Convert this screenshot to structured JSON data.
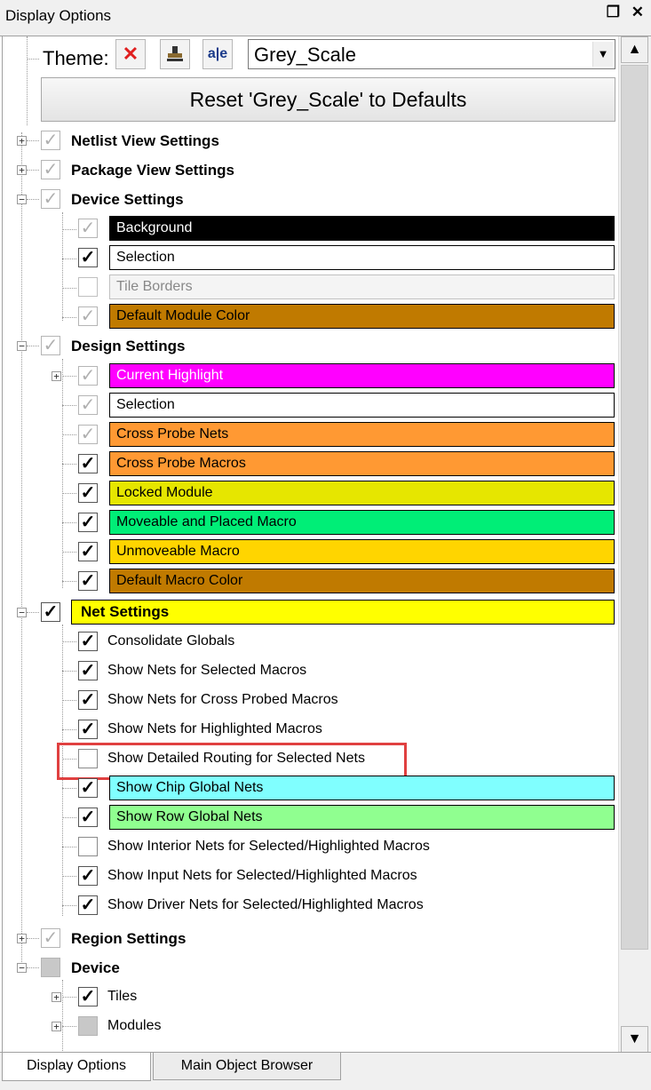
{
  "window": {
    "title": "Display Options",
    "pin_glyph": "❐",
    "close_glyph": "✕"
  },
  "theme": {
    "label": "Theme:",
    "delete_icon": "✕",
    "stamp_icon": "▒",
    "rename_icon": "a|e",
    "selected": "Grey_Scale",
    "reset_label": "Reset 'Grey_Scale' to Defaults"
  },
  "tree": {
    "netlist_view": "Netlist View Settings",
    "package_view": "Package View Settings",
    "device_settings": {
      "label": "Device Settings",
      "items": [
        "Background",
        "Selection",
        "Tile Borders",
        "Default Module Color"
      ]
    },
    "design_settings": {
      "label": "Design Settings",
      "items": [
        "Current Highlight",
        "Selection",
        "Cross Probe Nets",
        "Cross Probe Macros",
        "Locked Module",
        "Moveable and Placed Macro",
        "Unmoveable Macro",
        "Default Macro Color"
      ]
    },
    "net_settings": {
      "label": "Net Settings",
      "items": [
        "Consolidate Globals",
        "Show Nets for Selected Macros",
        "Show Nets for Cross Probed Macros",
        "Show Nets for Highlighted Macros",
        "Show Detailed Routing for Selected Nets",
        "Show Chip Global Nets",
        "Show Row Global Nets",
        "Show Interior Nets for Selected/Highlighted Macros",
        "Show Input Nets for Selected/Highlighted Macros",
        "Show Driver Nets for Selected/Highlighted Macros"
      ]
    },
    "region_settings": "Region Settings",
    "device": {
      "label": "Device",
      "items": [
        "Tiles",
        "Modules"
      ]
    }
  },
  "colors": {
    "background": "#000000",
    "selection": "#ffffff",
    "tile_borders": "#f4f4f4",
    "default_module": "#c07a00",
    "current_highlight": "#ff00ff",
    "cross_probe_nets": "#ff9933",
    "cross_probe_macros": "#ff9933",
    "locked_module": "#e6e600",
    "moveable_placed": "#00ee77",
    "unmoveable": "#ffd500",
    "default_macro": "#c07a00",
    "net_settings": "#ffff00",
    "chip_global": "#80ffff",
    "row_global": "#90ff90",
    "highlight_box": "#e04040"
  },
  "tabs": [
    "Display Options",
    "Main Object Browser"
  ],
  "scroll": {
    "up": "▲",
    "down": "▼"
  }
}
